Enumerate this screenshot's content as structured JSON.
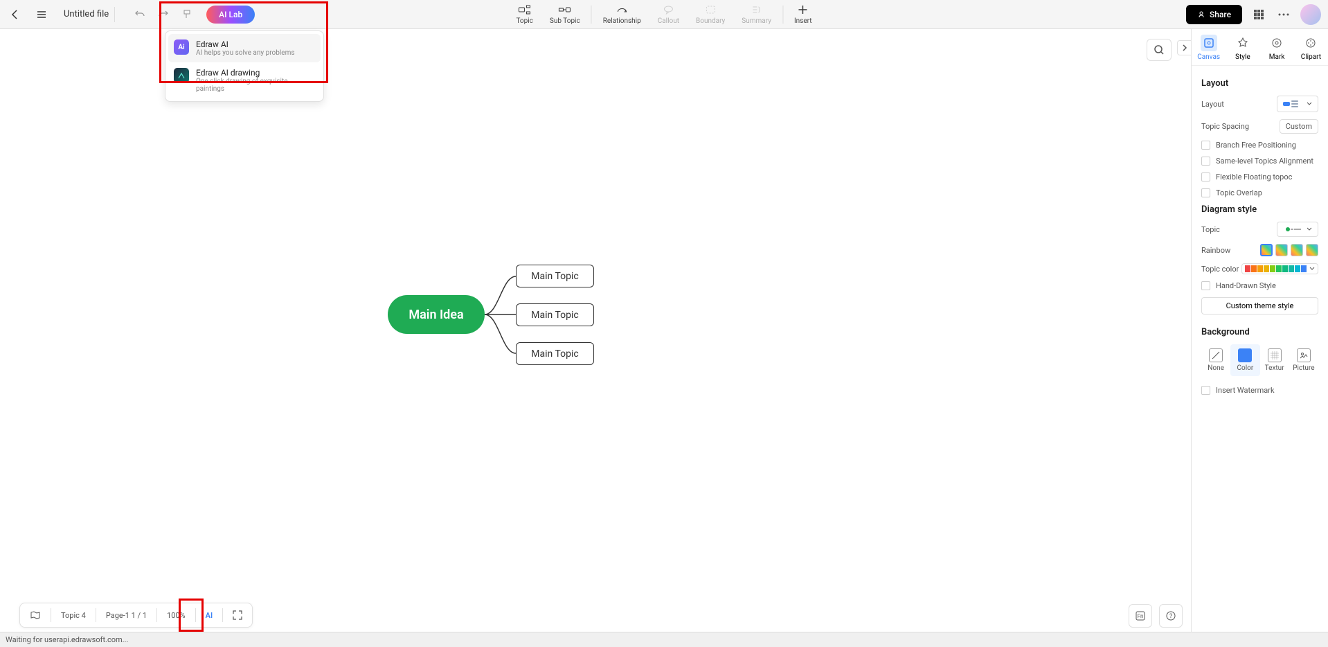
{
  "header": {
    "filename": "Untitled file",
    "ai_lab": "AI Lab",
    "share": "Share"
  },
  "tools": {
    "topic": "Topic",
    "subtopic": "Sub Topic",
    "relationship": "Relationship",
    "callout": "Callout",
    "boundary": "Boundary",
    "summary": "Summary",
    "insert": "Insert"
  },
  "ai_menu": {
    "item1_title": "Edraw AI",
    "item1_sub": "AI helps you solve any problems",
    "item2_title": "Edraw AI drawing",
    "item2_sub": "One click drawing of exquisite paintings",
    "icon1_text": "Ai"
  },
  "mindmap": {
    "main": "Main Idea",
    "topic1": "Main Topic",
    "topic2": "Main Topic",
    "topic3": "Main Topic"
  },
  "panel": {
    "tabs": {
      "canvas": "Canvas",
      "style": "Style",
      "mark": "Mark",
      "clipart": "Clipart"
    },
    "layout_section": "Layout",
    "layout_label": "Layout",
    "topic_spacing": "Topic Spacing",
    "custom": "Custom",
    "branch_free": "Branch Free Positioning",
    "same_level": "Same-level Topics Alignment",
    "flexible": "Flexible Floating topoc",
    "overlap": "Topic Overlap",
    "diagram_style": "Diagram style",
    "topic_label": "Topic",
    "rainbow": "Rainbow",
    "topic_color": "Topic color",
    "hand_drawn": "Hand-Drawn Style",
    "custom_theme": "Custom theme style",
    "background": "Background",
    "bg_none": "None",
    "bg_color": "Color",
    "bg_textur": "Textur",
    "bg_picture": "Picture",
    "watermark": "Insert Watermark"
  },
  "bottom": {
    "topic_count": "Topic 4",
    "page": "Page-1  1 / 1",
    "zoom": "100%",
    "ai": "AI"
  },
  "status": "Waiting for userapi.edrawsoft.com...",
  "colors": {
    "palette": [
      "#ef4444",
      "#f97316",
      "#f59e0b",
      "#eab308",
      "#84cc16",
      "#22c55e",
      "#10b981",
      "#14b8a6",
      "#06b6d4",
      "#3b82f6"
    ]
  }
}
